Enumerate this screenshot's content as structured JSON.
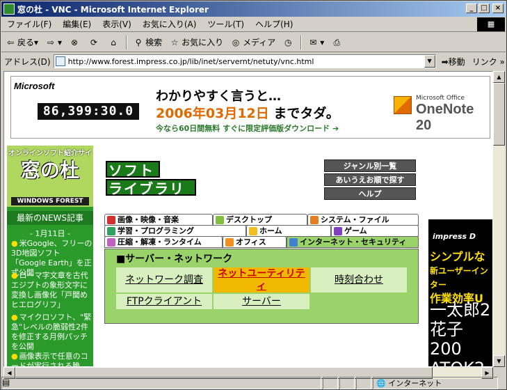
{
  "window": {
    "title": "窓の杜 - VNC - Microsoft Internet Explorer"
  },
  "menu": [
    "ファイル(F)",
    "編集(E)",
    "表示(V)",
    "お気に入り(A)",
    "ツール(T)",
    "ヘルプ(H)"
  ],
  "toolbar": {
    "back": "戻る",
    "search": "検索",
    "favorites": "お気に入り",
    "media": "メディア"
  },
  "address": {
    "label": "アドレス(D)",
    "url": "http://www.forest.impress.co.jp/lib/inet/servernt/netuty/vnc.html",
    "go": "移動",
    "links": "リンク"
  },
  "status": {
    "zone": "インターネット"
  },
  "ad": {
    "brand": "Microsoft",
    "counter": "86,399:30.0",
    "line1": "わかりやすく言うと…",
    "date": "2006年03月12日",
    "until": "までタダ。",
    "line3": "今なら60日間無料 すぐに限定評価版ダウンロード",
    "product_small": "Microsoft Office",
    "product": "OneNote 20"
  },
  "sidebar": {
    "subtitle": "オンラインソフト紹介サイト",
    "logo": "窓の杜",
    "logo_en": "WINDOWS FOREST",
    "news": "最新のNEWS記事",
    "date": "- 1月11日 -",
    "items": [
      "米Google、フリーの3D地図ソフト「Google Earth」を正式公開",
      "ローマ字文章を古代エジプトの象形文字に変換し画像化「戸聞めヒエログリフ」",
      "マイクロソフト、\"緊急\"レベルの脆弱性2件を修正する月例パッチを公開",
      "画像表示で任意のコードが実行される脆"
    ]
  },
  "library": {
    "title1": "ソフト",
    "title2": "ライブラリ",
    "buttons": [
      "ジャンル別一覧",
      "あいうえお順で探す",
      "ヘルプ"
    ]
  },
  "tabs": [
    {
      "label": "画像・映像・音楽",
      "color": "#d03030"
    },
    {
      "label": "デスクトップ",
      "color": "#80c040"
    },
    {
      "label": "システム・ファイル",
      "color": "#e08020"
    },
    {
      "label": "学習・プログラミング",
      "color": "#30a060"
    },
    {
      "label": "ホーム",
      "color": "#f0c020"
    },
    {
      "label": "ゲーム",
      "color": "#8040c0"
    },
    {
      "label": "圧縮・解凍・ランタイム",
      "color": "#c060c0"
    },
    {
      "label": "オフィス",
      "color": "#f09020"
    },
    {
      "label": "インターネット・セキュリティ",
      "color": "#4080d0"
    }
  ],
  "panel": {
    "title": "■サーバー・ネットワーク",
    "cats": [
      "ネットワーク調査",
      "ネットユーティリティ",
      "時刻合わせ",
      "FTPクライアント",
      "サーバー"
    ]
  },
  "right_banner": {
    "brand": "impress D",
    "line1": "シンプルな",
    "line2": "新ユーザーインター",
    "line3": "作業効率U",
    "big1": "一太郎2",
    "big2": "花子200",
    "big3": "ATOK2"
  }
}
